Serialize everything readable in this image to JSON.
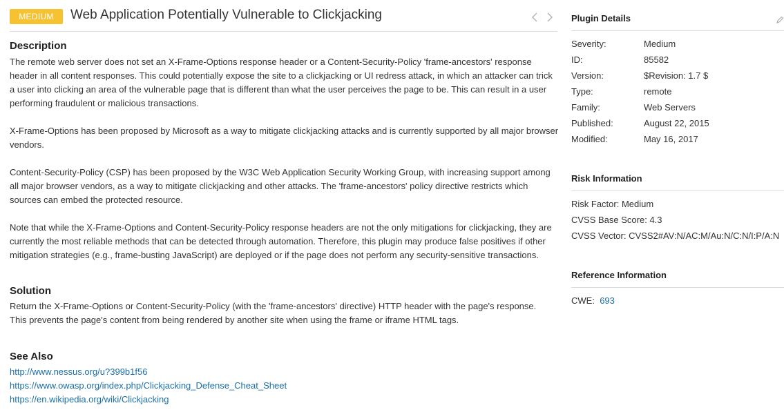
{
  "header": {
    "severity_badge": "MEDIUM",
    "title": "Web Application Potentially Vulnerable to Clickjacking",
    "badge_color": "#f7c231"
  },
  "description": {
    "heading": "Description",
    "paragraphs": [
      "The remote web server does not set an X-Frame-Options response header or a Content-Security-Policy 'frame-ancestors' response header in all content responses. This could potentially expose the site to a clickjacking or UI redress attack, in which an attacker can trick a user into clicking an area of the vulnerable page that is different than what the user perceives the page to be. This can result in a user performing fraudulent or malicious transactions.",
      "X-Frame-Options has been proposed by Microsoft as a way to mitigate clickjacking attacks and is currently supported by all major browser vendors.",
      "Content-Security-Policy (CSP) has been proposed by the W3C Web Application Security Working Group, with increasing support among all major browser vendors, as a way to mitigate clickjacking and other attacks. The 'frame-ancestors' policy directive restricts which sources can embed the protected resource.",
      "Note that while the X-Frame-Options and Content-Security-Policy response headers are not the only mitigations for clickjacking, they are currently the most reliable methods that can be detected through automation. Therefore, this plugin may produce false positives if other mitigation strategies (e.g., frame-busting JavaScript) are deployed or if the page does not perform any security-sensitive transactions."
    ]
  },
  "solution": {
    "heading": "Solution",
    "lines": [
      "Return the X-Frame-Options or Content-Security-Policy (with the 'frame-ancestors' directive) HTTP header with the page's response.",
      "This prevents the page's content from being rendered by another site when using the frame or iframe HTML tags."
    ]
  },
  "see_also": {
    "heading": "See Also",
    "links": [
      "http://www.nessus.org/u?399b1f56",
      "https://www.owasp.org/index.php/Clickjacking_Defense_Cheat_Sheet",
      "https://en.wikipedia.org/wiki/Clickjacking"
    ]
  },
  "plugin_details": {
    "heading": "Plugin Details",
    "rows": [
      {
        "key": "Severity:",
        "value": "Medium"
      },
      {
        "key": "ID:",
        "value": "85582"
      },
      {
        "key": "Version:",
        "value": "$Revision: 1.7 $"
      },
      {
        "key": "Type:",
        "value": "remote"
      },
      {
        "key": "Family:",
        "value": "Web Servers"
      },
      {
        "key": "Published:",
        "value": "August 22, 2015"
      },
      {
        "key": "Modified:",
        "value": "May 16, 2017"
      }
    ]
  },
  "risk_information": {
    "heading": "Risk Information",
    "lines": [
      "Risk Factor: Medium",
      "CVSS Base Score: 4.3",
      "CVSS Vector: CVSS2#AV:N/AC:M/Au:N/C:N/I:P/A:N"
    ]
  },
  "reference_information": {
    "heading": "Reference Information",
    "cwe_label": "CWE:",
    "cwe_value": "693"
  },
  "colors": {
    "link": "#1b6fa8",
    "divider": "#dcdcdc"
  }
}
